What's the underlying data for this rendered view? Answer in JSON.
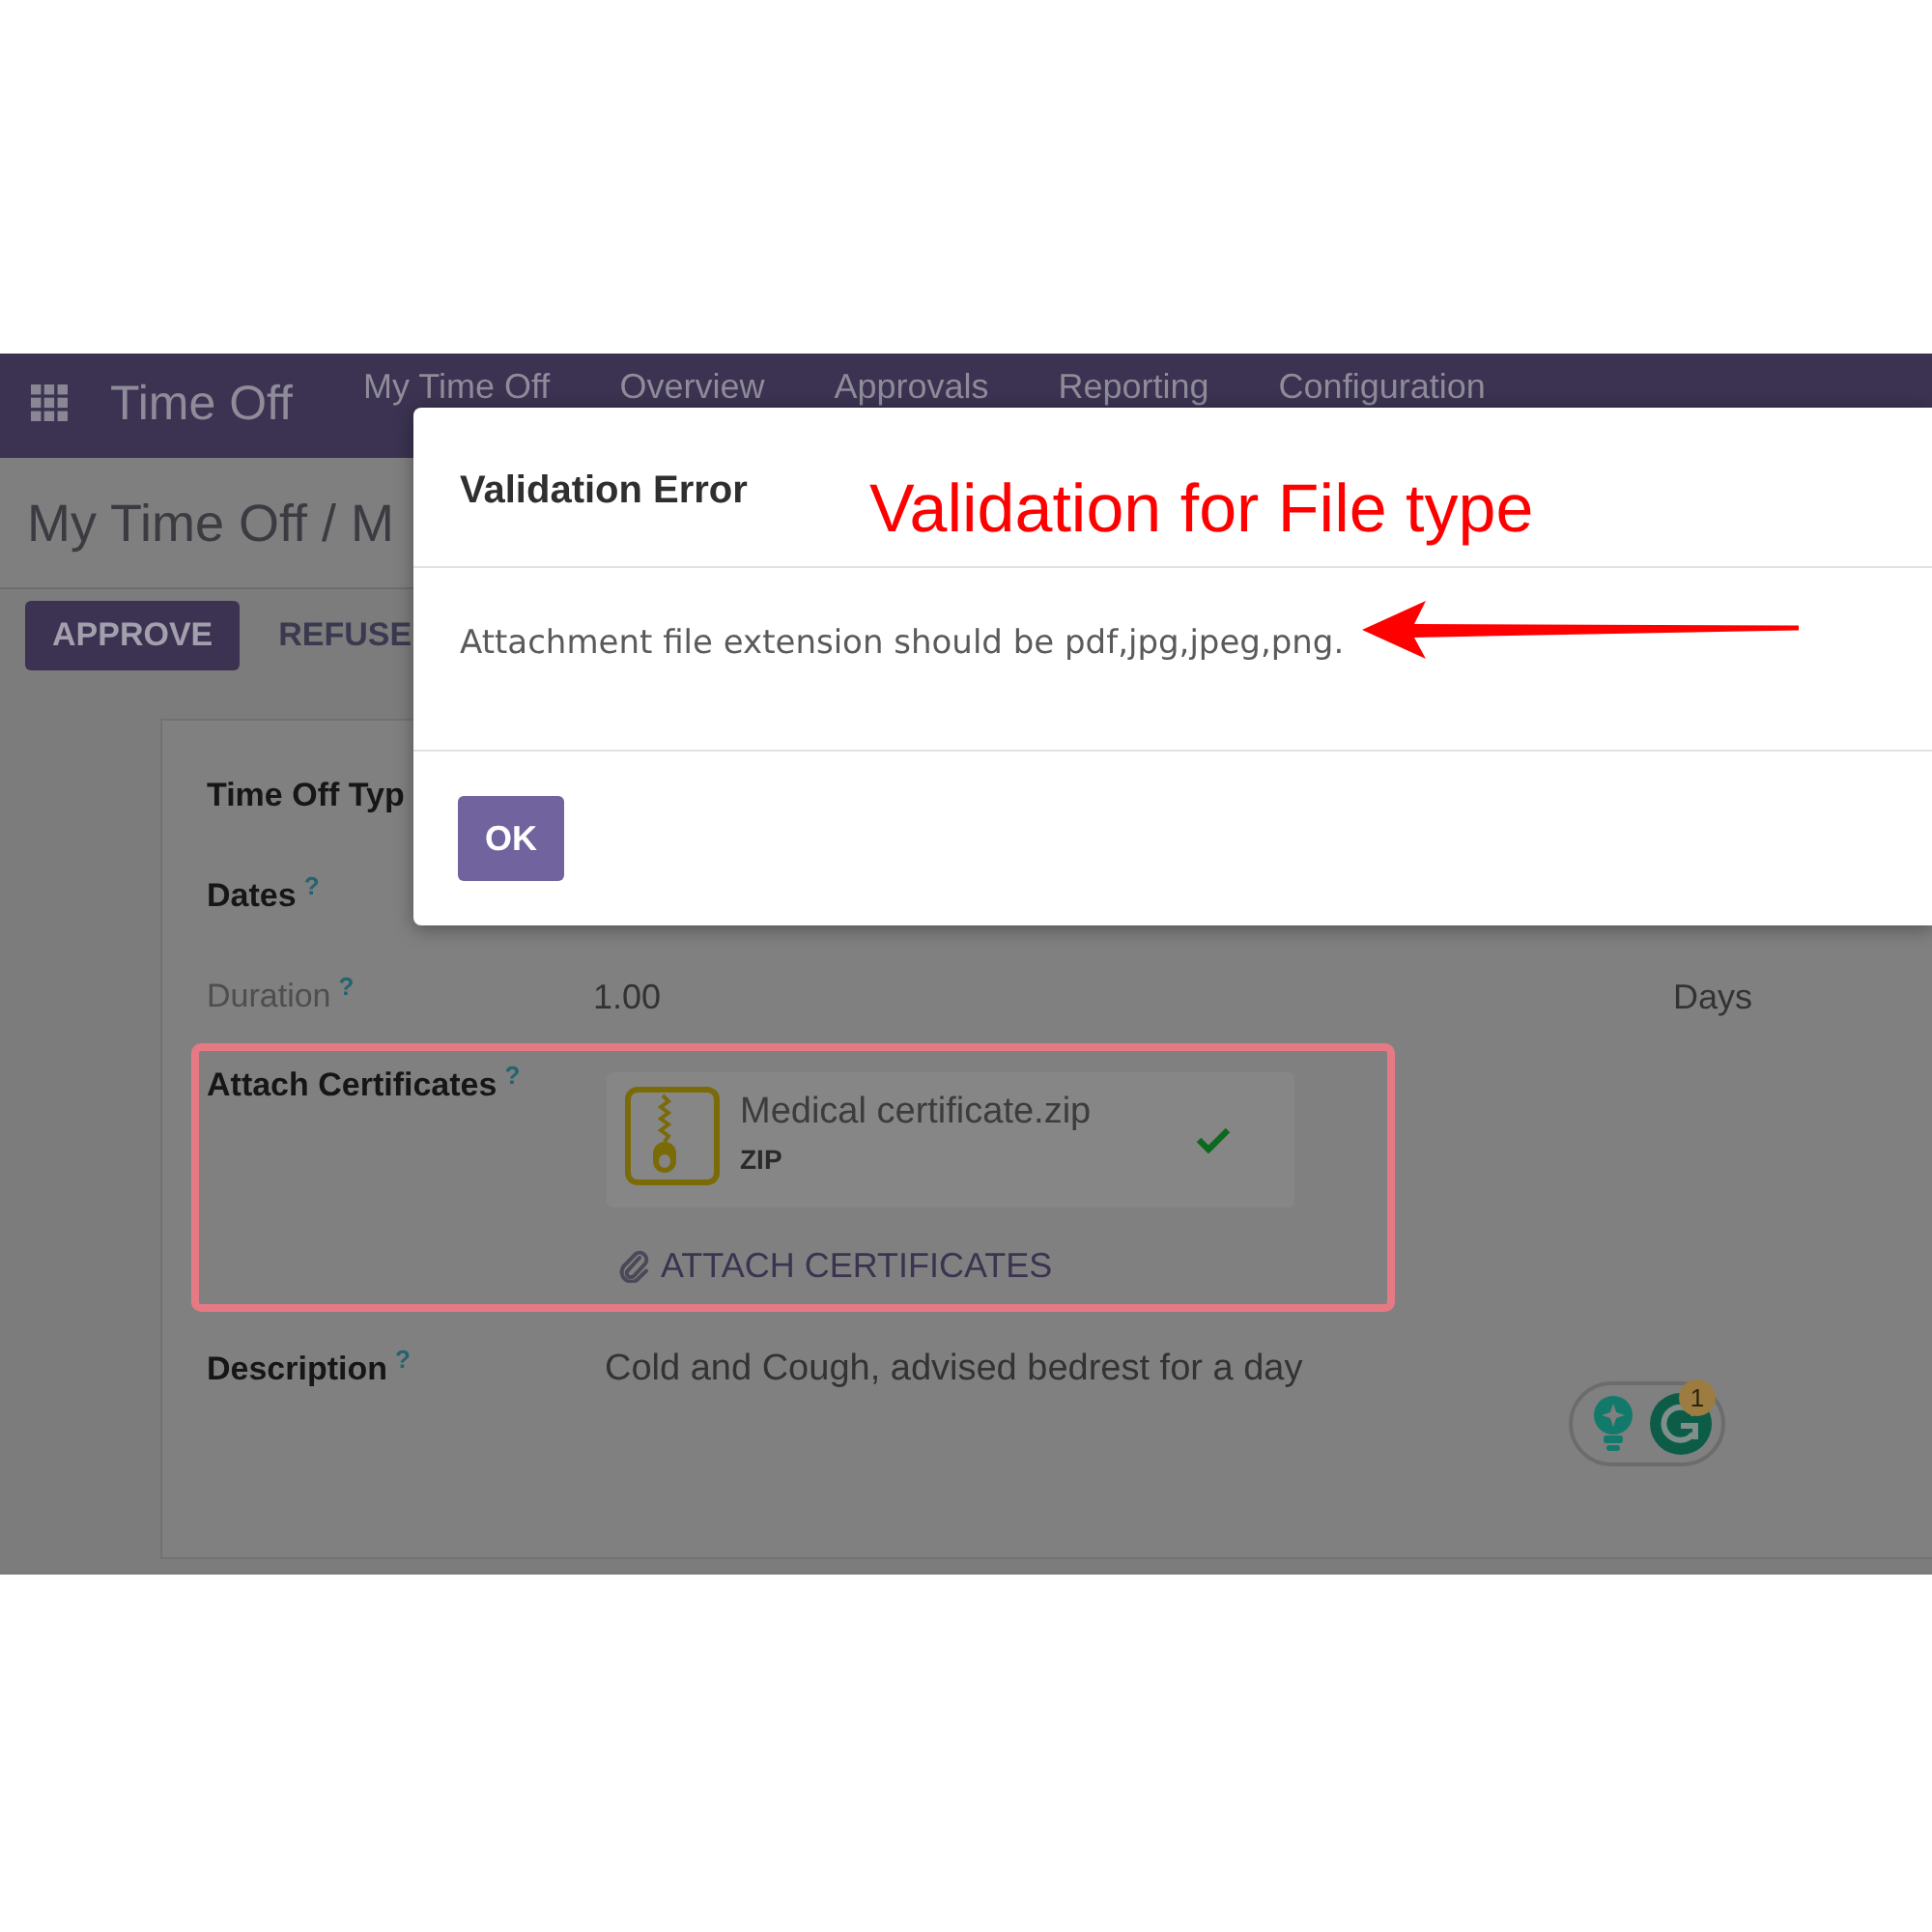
{
  "navbar": {
    "app_name": "Time Off",
    "menu": [
      {
        "label": "My Time Off",
        "selected": false
      },
      {
        "label": "Overview",
        "selected": false
      },
      {
        "label": "Approvals",
        "selected": false
      },
      {
        "label": "Reporting",
        "selected": false
      },
      {
        "label": "Configuration",
        "selected": false
      }
    ]
  },
  "breadcrumb": "My Time Off / M",
  "actions": [
    {
      "label": "APPROVE",
      "kind": "primary"
    },
    {
      "label": "REFUSE",
      "kind": "secondary"
    }
  ],
  "form": {
    "fields": [
      {
        "kind": "text",
        "label": "Time Off Typ",
        "readonly": false
      },
      {
        "kind": "text",
        "label": "Dates",
        "help": "?",
        "readonly": false
      },
      {
        "kind": "text",
        "label": "Duration",
        "help": "?",
        "readonly": true,
        "value": "1.00",
        "unit": "Days"
      },
      {
        "kind": "attachments",
        "label": "Attach Certificates",
        "help": "?",
        "readonly": false,
        "highlighted": true,
        "files": [
          {
            "name": "Medical certificate.zip",
            "type": "ZIP",
            "uploaded": true
          }
        ],
        "action": "ATTACH CERTIFICATES"
      },
      {
        "kind": "text",
        "label": "Description",
        "help": "?",
        "readonly": false,
        "value": "Cold and Cough, advised bedrest for a day"
      }
    ]
  },
  "assistant": {
    "badge": "1"
  },
  "dialog": {
    "title": "Validation Error",
    "message": "Attachment file extension should be pdf,jpg,jpeg,png.",
    "button": "OK"
  },
  "annotation": {
    "callout": "Validation for File type",
    "arrow": true
  }
}
